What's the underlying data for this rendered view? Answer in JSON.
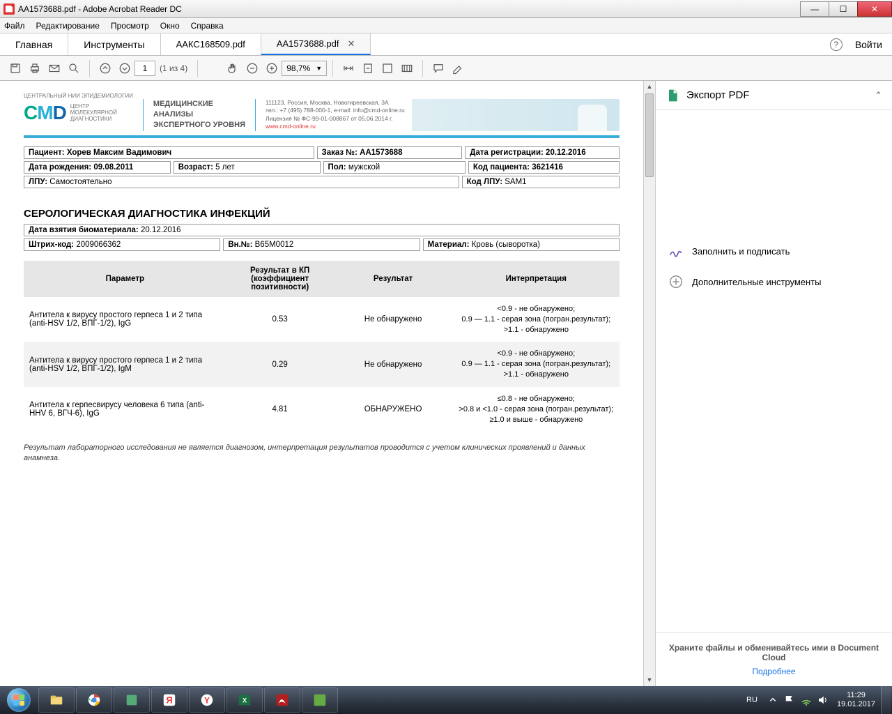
{
  "window": {
    "title": "AA1573688.pdf - Adobe Acrobat Reader DC"
  },
  "menu": {
    "file": "Файл",
    "edit": "Редактирование",
    "view": "Просмотр",
    "window": "Окно",
    "help": "Справка"
  },
  "apptabs": {
    "home": "Главная",
    "tools": "Инструменты",
    "doc1": "ААКС168509.pdf",
    "doc2": "AA1573688.pdf",
    "login": "Войти"
  },
  "toolbar": {
    "page_current": "1",
    "page_total": "(1 из 4)",
    "zoom": "98,7%"
  },
  "sidebar": {
    "export": "Экспорт PDF",
    "fill": "Заполнить и подписать",
    "more": "Дополнительные инструменты",
    "footer1": "Храните файлы и обменивайтесь ими в Document Cloud",
    "footer2": "Подробнее"
  },
  "letterhead": {
    "topline": "Центральный НИИ Эпидемиологии",
    "sub1": "ЦЕНТР",
    "sub2": "МОЛЕКУЛЯРНОЙ",
    "sub3": "ДИАГНОСТИКИ",
    "mid1": "МЕДИЦИНСКИЕ",
    "mid2": "АНАЛИЗЫ",
    "mid3": "ЭКСПЕРТНОГО УРОВНЯ",
    "addr1": "111123, Россия, Москва, Новогиреевская, 3А",
    "addr2": "тел.: +7 (495) 788-000-1, e-mail: info@cmd-online.ru",
    "addr3": "Лицензия № ФС-99-01-008867 от 05.06.2014 г.",
    "site": "www.cmd-online.ru"
  },
  "info": {
    "patient_l": "Пациент:",
    "patient_v": "Хорев Максим Вадимович",
    "order_l": "Заказ №:",
    "order_v": "AA1573688",
    "regdate_l": "Дата регистрации:",
    "regdate_v": "20.12.2016",
    "dob_l": "Дата рождения:",
    "dob_v": "09.08.2011",
    "age_l": "Возраст:",
    "age_v": "5 лет",
    "sex_l": "Пол:",
    "sex_v": "мужской",
    "pcode_l": "Код пациента:",
    "pcode_v": "3621416",
    "lpu_l": "ЛПУ:",
    "lpu_v": "Самостоятельно",
    "lpucode_l": "Код ЛПУ:",
    "lpucode_v": "SAM1"
  },
  "section": {
    "title": "СЕРОЛОГИЧЕСКАЯ ДИАГНОСТИКА ИНФЕКЦИЙ",
    "sampledate_l": "Дата взятия биоматериала:",
    "sampledate_v": "20.12.2016",
    "barcode_l": "Штрих-код:",
    "barcode_v": "2009066362",
    "vn_l": "Вн.№:",
    "vn_v": "B65M0012",
    "material_l": "Материал:",
    "material_v": "Кровь (сыворотка)"
  },
  "headers": {
    "param": "Параметр",
    "kp": "Результат в КП (коэффициент позитивности)",
    "result": "Результат",
    "interp": "Интерпретация"
  },
  "rows": [
    {
      "param": "Антитела к вирусу простого герпеса 1 и 2 типа (anti-HSV 1/2, ВПГ-1/2), IgG",
      "kp": "0.53",
      "result": "Не обнаружено",
      "interp": "<0.9 - не обнаружено;\n0.9 — 1.1 - серая зона (погран.результат);\n>1.1 - обнаружено"
    },
    {
      "param": "Антитела к вирусу простого герпеса 1 и 2 типа (anti-HSV 1/2, ВПГ-1/2), IgM",
      "kp": "0.29",
      "result": "Не обнаружено",
      "interp": "<0.9 - не обнаружено;\n0.9 — 1.1 - серая зона (погран.результат);\n>1.1 - обнаружено"
    },
    {
      "param": "Антитела к герпесвирусу человека 6 типа (anti-HHV 6, ВГЧ-6), IgG",
      "kp": "4.81",
      "result": "ОБНАРУЖЕНО",
      "interp": "≤0.8 - не обнаружено;\n>0.8 и <1.0 - серая зона (погран.результат);\n≥1.0 и выше - обнаружено"
    }
  ],
  "footnote": "Результат лабораторного исследования не является диагнозом, интерпретация результатов проводится с учетом клинических проявлений и данных анамнеза.",
  "taskbar": {
    "lang": "RU",
    "time": "11:29",
    "date": "19.01.2017"
  }
}
